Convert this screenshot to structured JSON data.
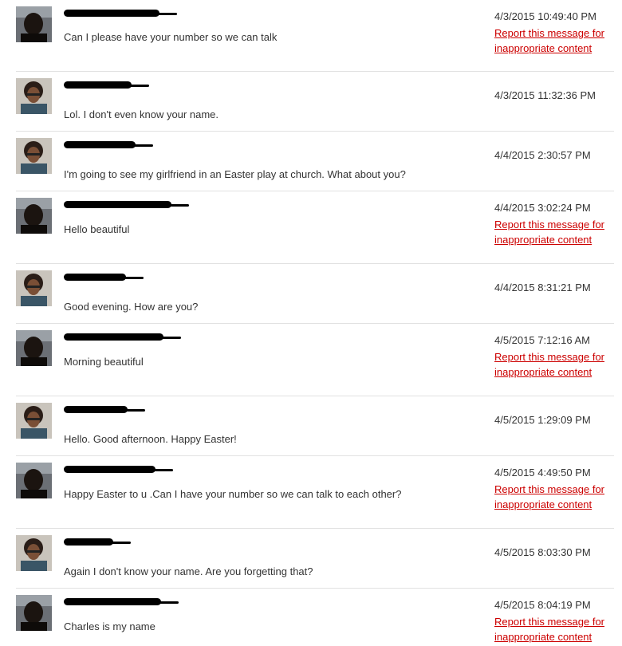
{
  "report_link": {
    "line1": "Report this message for",
    "line2": "inappropriate content",
    "color": "#cc0000"
  },
  "messages": [
    {
      "avatar": "man-avatar",
      "text": "Can I please have your number so we can talk",
      "time": "4/3/2015 10:49:40 PM",
      "reportable": true
    },
    {
      "avatar": "woman-avatar",
      "text": "Lol. I don't even know your name.",
      "time": "4/3/2015 11:32:36 PM",
      "reportable": false
    },
    {
      "avatar": "woman-avatar",
      "text": "I'm going to see my girlfriend in an Easter play at church. What about you?",
      "time": "4/4/2015 2:30:57 PM",
      "reportable": false
    },
    {
      "avatar": "man-avatar",
      "text": "Hello beautiful",
      "time": "4/4/2015 3:02:24 PM",
      "reportable": true
    },
    {
      "avatar": "woman-avatar",
      "text": "Good evening. How are you?",
      "time": "4/4/2015 8:31:21 PM",
      "reportable": false
    },
    {
      "avatar": "man-avatar",
      "text": "Morning beautiful",
      "time": "4/5/2015 7:12:16 AM",
      "reportable": true
    },
    {
      "avatar": "woman-avatar",
      "text": "Hello. Good afternoon. Happy Easter!",
      "time": "4/5/2015 1:29:09 PM",
      "reportable": false
    },
    {
      "avatar": "man-avatar",
      "text": "Happy Easter to u .Can I have your number so we can talk to each other?",
      "time": "4/5/2015 4:49:50 PM",
      "reportable": true
    },
    {
      "avatar": "woman-avatar",
      "text": "Again I don't know your name. Are you forgetting that?",
      "time": "4/5/2015 8:03:30 PM",
      "reportable": false
    },
    {
      "avatar": "man-avatar",
      "text": "Charles is my name",
      "time": "4/5/2015 8:04:19 PM",
      "reportable": true
    }
  ]
}
